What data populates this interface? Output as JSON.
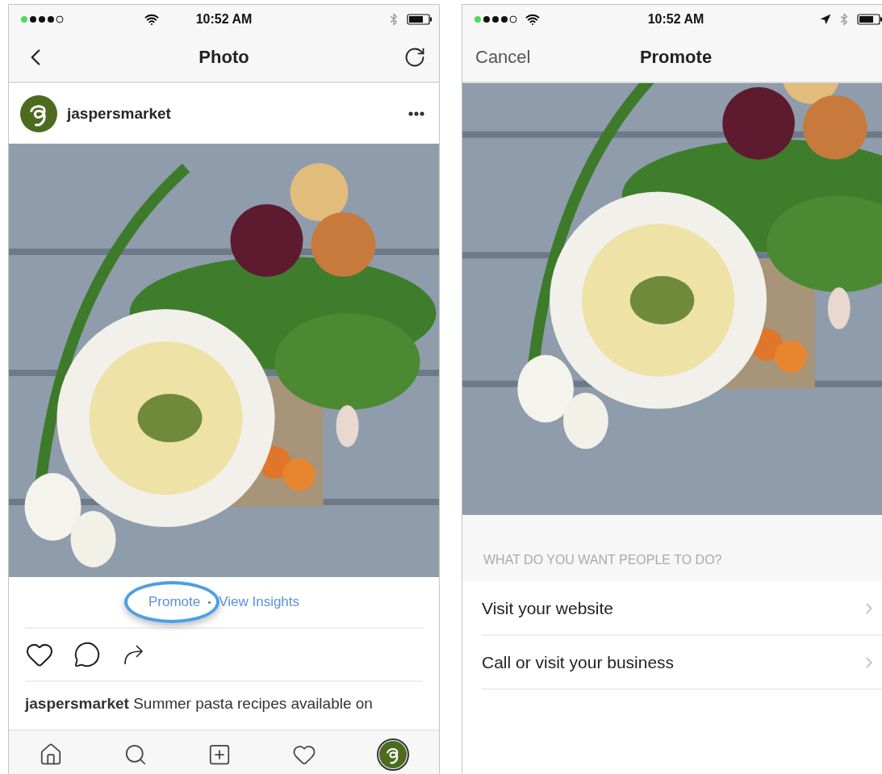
{
  "left_screen": {
    "status_bar": {
      "time": "10:52 AM",
      "location": false
    },
    "nav": {
      "title": "Photo"
    },
    "post": {
      "username": "jaspersmarket",
      "links": [
        {
          "label": "Promote",
          "circled": true
        },
        {
          "label": "View Insights",
          "circled": false
        }
      ],
      "caption": {
        "username": "jaspersmarket",
        "text": "Summer pasta recipes available on"
      }
    },
    "tab_bar": [
      {
        "kind": "home",
        "selected": false
      },
      {
        "kind": "search",
        "selected": false
      },
      {
        "kind": "add",
        "selected": false
      },
      {
        "kind": "activity",
        "selected": false
      },
      {
        "kind": "profile",
        "selected": true
      }
    ]
  },
  "right_screen": {
    "status_bar": {
      "time": "10:52 AM",
      "location": true
    },
    "nav": {
      "cancel": "Cancel",
      "title": "Promote"
    },
    "section_header": "WHAT DO YOU WANT PEOPLE TO DO?",
    "options": [
      {
        "label": "Visit your website"
      },
      {
        "label": "Call or visit your business"
      }
    ]
  }
}
